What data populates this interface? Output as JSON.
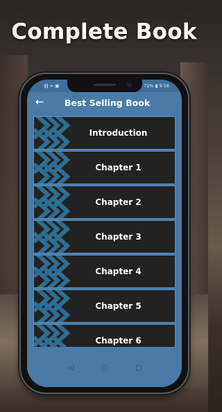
{
  "banner": {
    "title": "Complete Book"
  },
  "statusbar": {
    "left": "·∥∥ ≈ ▣",
    "right": "72% ▮ 9:58"
  },
  "appbar": {
    "back_icon": "arrow-left-icon",
    "title": "Best Selling Book"
  },
  "chapters": [
    {
      "label": "Introduction"
    },
    {
      "label": "Chapter 1"
    },
    {
      "label": "Chapter 2"
    },
    {
      "label": "Chapter 3"
    },
    {
      "label": "Chapter 4"
    },
    {
      "label": "Chapter 5"
    },
    {
      "label": "Chapter 6"
    }
  ],
  "navbar": {
    "back": "◁",
    "home": "○",
    "recent": "□"
  },
  "colors": {
    "accent": "#4a7ba7",
    "item_bg": "#222222",
    "item_border": "#5a8fc0",
    "pattern": "#2f6d91"
  }
}
